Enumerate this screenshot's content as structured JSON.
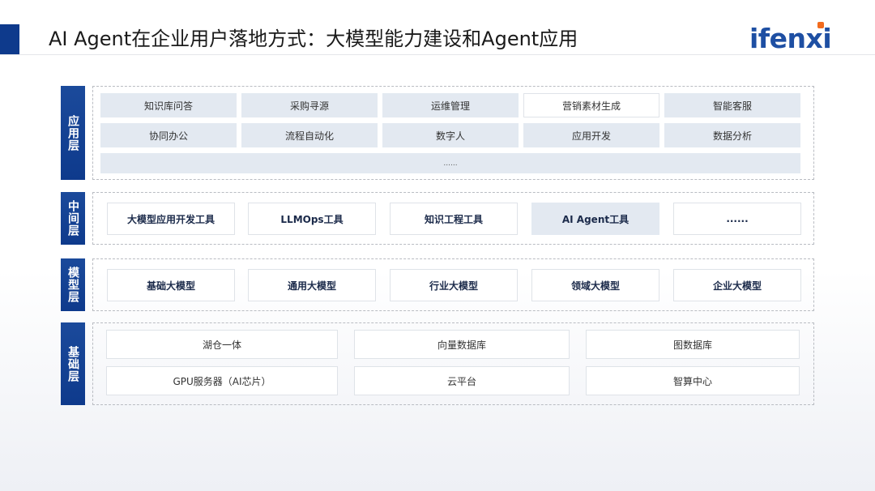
{
  "header": {
    "title": "AI Agent在企业用户落地方式：大模型能力建设和Agent应用",
    "logo": "ifenxi"
  },
  "layers": {
    "application": {
      "label": "应用层",
      "row1": [
        "知识库问答",
        "采购寻源",
        "运维管理",
        "营销素材生成",
        "智能客服"
      ],
      "row2": [
        "协同办公",
        "流程自动化",
        "数字人",
        "应用开发",
        "数据分析"
      ],
      "row3": "......"
    },
    "middle": {
      "label": "中间层",
      "items": [
        "大模型应用开发工具",
        "LLMOps工具",
        "知识工程工具",
        "AI Agent工具",
        "......"
      ]
    },
    "model": {
      "label": "模型层",
      "items": [
        "基础大模型",
        "通用大模型",
        "行业大模型",
        "领域大模型",
        "企业大模型"
      ]
    },
    "base": {
      "label": "基础层",
      "row1": [
        "湖仓一体",
        "向量数据库",
        "图数据库"
      ],
      "row2": [
        "GPU服务器（AI芯片）",
        "云平台",
        "智算中心"
      ]
    }
  },
  "colors": {
    "accent": "#0e3a8c",
    "logo_blue": "#1e4fa3",
    "logo_dot": "#f26b1d",
    "cell_shade": "#e3e9f1"
  }
}
